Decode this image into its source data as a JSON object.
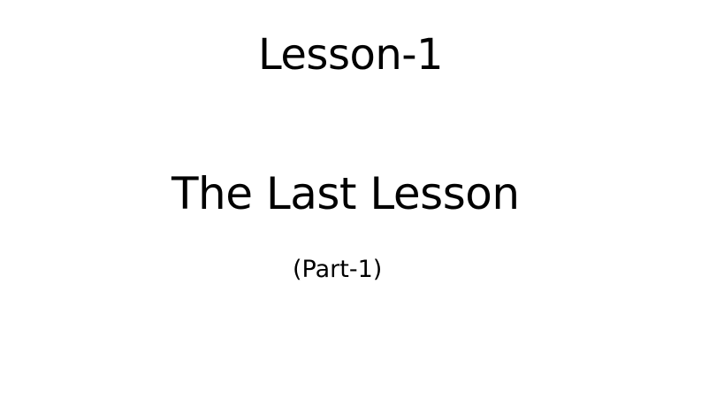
{
  "slide": {
    "heading": "Lesson-1",
    "title": "The Last Lesson",
    "subtitle": "(Part-1)"
  },
  "colors": {
    "background": "#ffffff",
    "text": "#000000"
  }
}
